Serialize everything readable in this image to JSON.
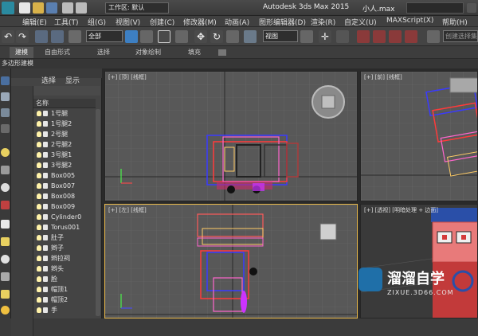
{
  "title_bar": {
    "workspace_label": "工作区: 默认",
    "app_title": "Autodesk 3ds Max  2015",
    "file_name": "小人.max"
  },
  "menu": {
    "items": [
      "编辑(E)",
      "工具(T)",
      "组(G)",
      "视图(V)",
      "创建(C)",
      "修改器(M)",
      "动画(A)",
      "图形编辑器(D)",
      "渲染(R)",
      "自定义(U)",
      "MAXScript(X)",
      "帮助(H)"
    ]
  },
  "toolbar": {
    "filter_select": "全部",
    "view_select": "视图",
    "selection_set": "创建选择集"
  },
  "ribbon": {
    "tabs": [
      "建模",
      "自由形式",
      "选择",
      "对象绘制",
      "填充"
    ],
    "sub_label": "多边形建模"
  },
  "scene_explorer": {
    "tab_select": "选择",
    "tab_display": "显示",
    "column_name": "名称",
    "objects": [
      "1号腿",
      "1号腿2",
      "2号腿",
      "2号腿2",
      "3号腿1",
      "3号腿2",
      "Box005",
      "Box007",
      "Box008",
      "Box009",
      "Cylinder0",
      "Torus001",
      "肚子",
      "辫子",
      "辫拉祠",
      "辫头",
      "脸",
      "帽顶1",
      "帽顶2",
      "手"
    ]
  },
  "viewports": {
    "top": "[+] [顶] [线框]",
    "front": "[+] [前] [线框]",
    "left": "[+] [左] [线框]",
    "perspective": "[+] [透视] [明暗处理 + 边面]"
  },
  "watermark": {
    "brand": "溜溜自学",
    "url": "ZIXUE.3D66.COM"
  },
  "colors": {
    "accent_highlight": "#e8b84a",
    "viewport_bg": "#585858",
    "grid": "#6a6a6a"
  }
}
